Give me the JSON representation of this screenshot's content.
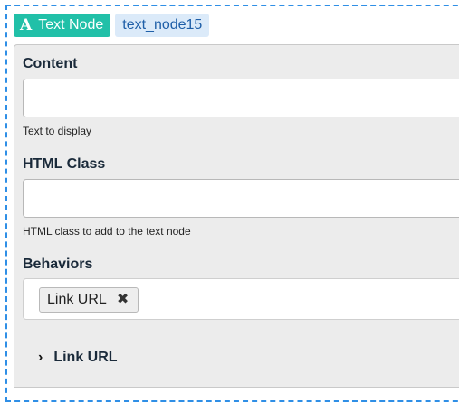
{
  "node": {
    "type_icon": "A",
    "type_label": "Text Node",
    "id": "text_node15"
  },
  "fields": {
    "content": {
      "label": "Content",
      "value": "",
      "help": "Text to display"
    },
    "html_class": {
      "label": "HTML Class",
      "value": "",
      "help": "HTML class to add to the text node"
    },
    "behaviors": {
      "label": "Behaviors",
      "tags": [
        {
          "label": "Link URL",
          "remove_icon": "✖"
        }
      ]
    }
  },
  "sections": [
    {
      "label": "Link URL",
      "chevron": "›",
      "expanded": false
    }
  ],
  "colors": {
    "frame_border": "#2f8fe6",
    "type_badge": "#21c0a8",
    "id_badge": "#dbeaf9"
  }
}
